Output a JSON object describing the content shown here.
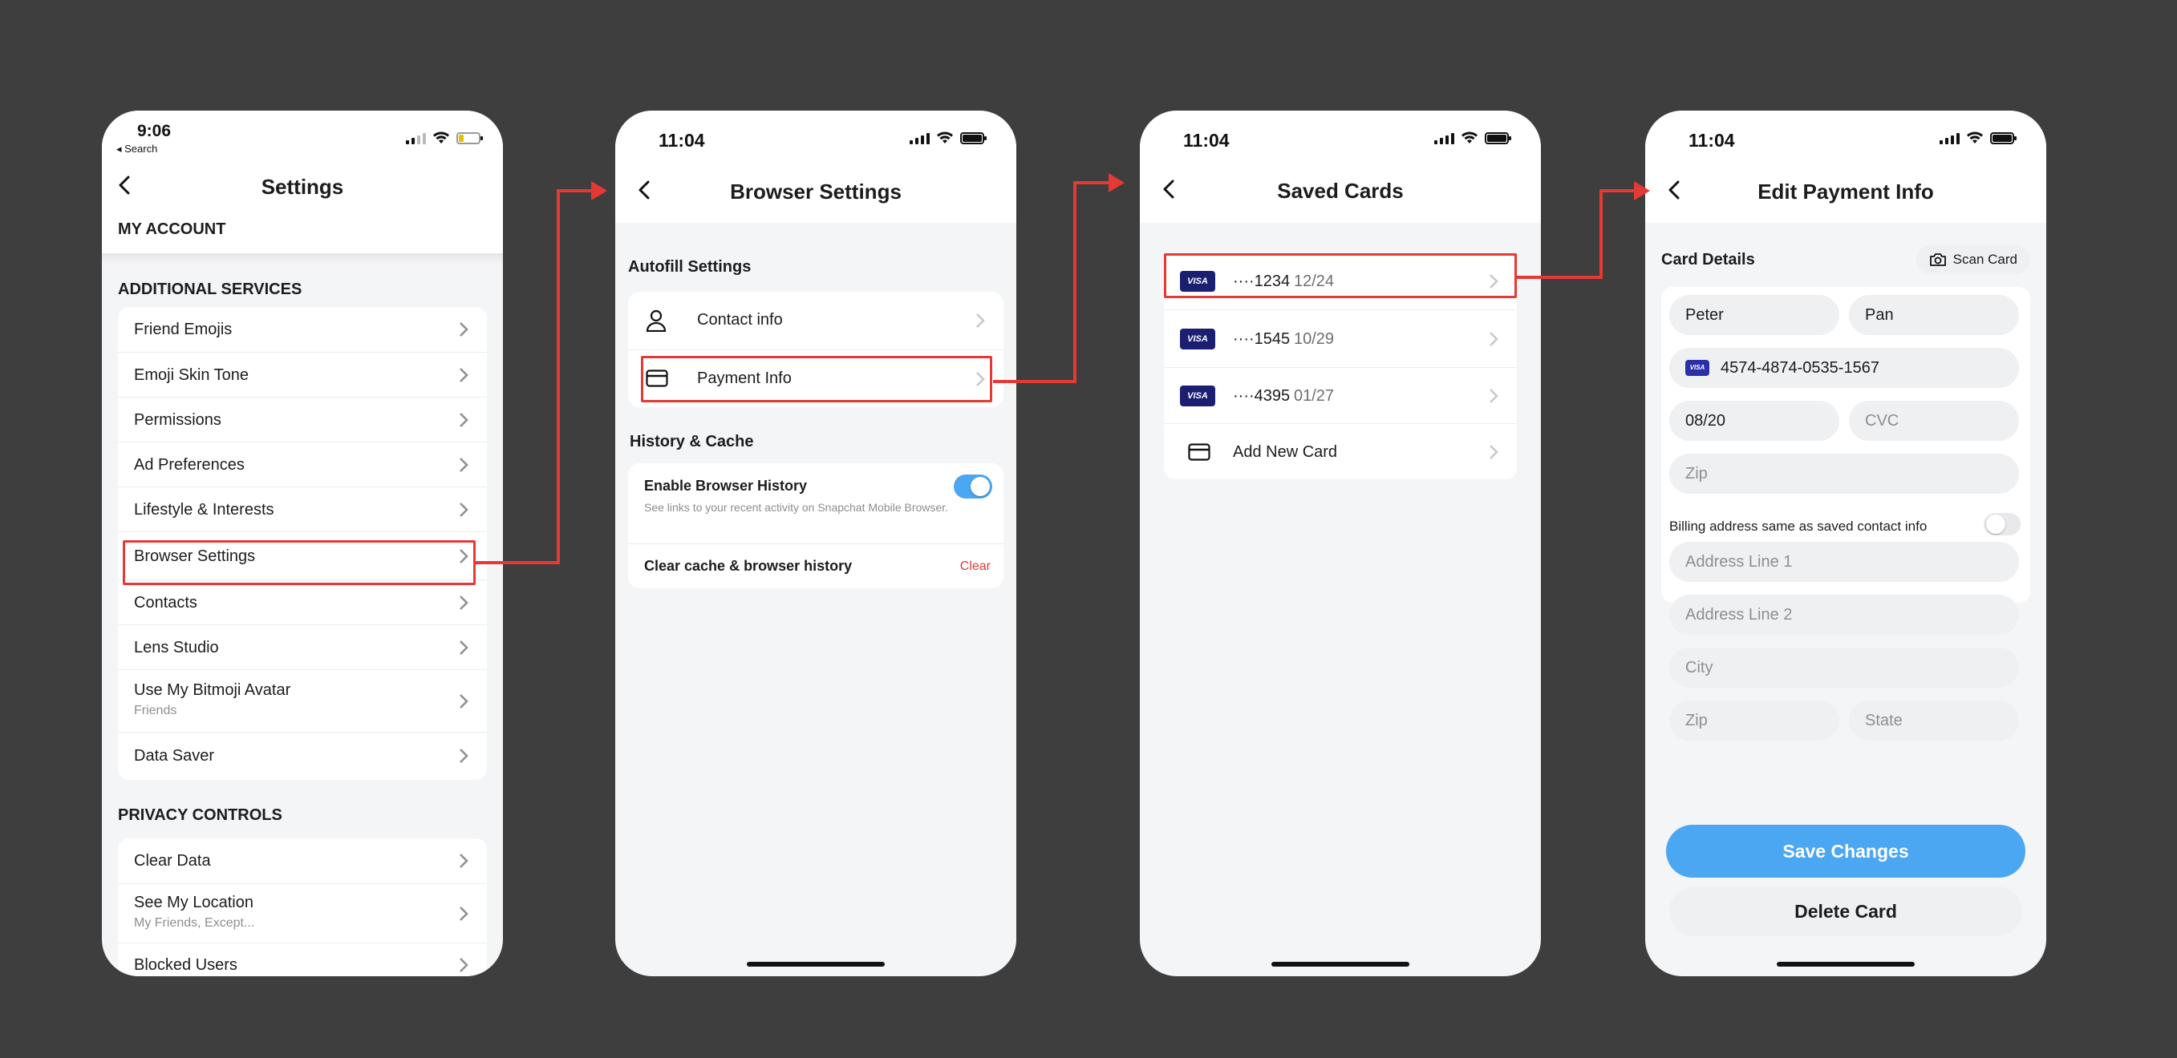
{
  "colors": {
    "accent": "#4ba7f2",
    "highlight": "#e53935",
    "danger": "#e53935",
    "background": "#3e3e3e",
    "visa": "#1a1f71"
  },
  "screen1": {
    "time": "9:06",
    "back_app": "◂ Search",
    "title": "Settings",
    "my_account": "MY ACCOUNT",
    "additional_services": "ADDITIONAL SERVICES",
    "items": [
      {
        "label": "Friend Emojis"
      },
      {
        "label": "Emoji Skin Tone"
      },
      {
        "label": "Permissions"
      },
      {
        "label": "Ad Preferences"
      },
      {
        "label": "Lifestyle & Interests"
      },
      {
        "label": "Browser Settings"
      },
      {
        "label": "Contacts"
      },
      {
        "label": "Lens Studio"
      },
      {
        "label": "Use My Bitmoji Avatar",
        "sub": "Friends"
      },
      {
        "label": "Data Saver"
      }
    ],
    "privacy_controls": "PRIVACY CONTROLS",
    "privacy_items": [
      {
        "label": "Clear Data"
      },
      {
        "label": "See My Location",
        "sub": "My Friends, Except..."
      },
      {
        "label": "Blocked Users"
      }
    ]
  },
  "screen2": {
    "time": "11:04",
    "title": "Browser Settings",
    "autofill": "Autofill Settings",
    "contact_info": "Contact info",
    "payment_info": "Payment Info",
    "history_cache": "History & Cache",
    "enable_history": "Enable Browser History",
    "enable_history_desc": "See links to your recent activity on Snapchat Mobile Browser.",
    "clear_cache": "Clear cache & browser history",
    "clear": "Clear",
    "history_enabled": true
  },
  "screen3": {
    "time": "11:04",
    "title": "Saved Cards",
    "cards": [
      {
        "brand": "VISA",
        "number": "····1234",
        "exp": "12/24"
      },
      {
        "brand": "VISA",
        "number": "····1545",
        "exp": "10/29"
      },
      {
        "brand": "VISA",
        "number": "····4395",
        "exp": "01/27"
      }
    ],
    "add_new": "Add New Card"
  },
  "screen4": {
    "time": "11:04",
    "title": "Edit Payment Info",
    "card_details": "Card Details",
    "scan_card": "Scan Card",
    "first_name": "Peter",
    "last_name": "Pan",
    "card_brand": "VISA",
    "card_number": "4574-4874-0535-1567",
    "expiry": "08/20",
    "cvc_placeholder": "CVC",
    "zip_placeholder": "Zip",
    "billing_same": "Billing address same as saved contact info",
    "billing_same_enabled": false,
    "address1_placeholder": "Address Line 1",
    "address2_placeholder": "Address Line 2",
    "city_placeholder": "City",
    "zip2_placeholder": "Zip",
    "state_placeholder": "State",
    "save": "Save Changes",
    "delete": "Delete Card"
  }
}
